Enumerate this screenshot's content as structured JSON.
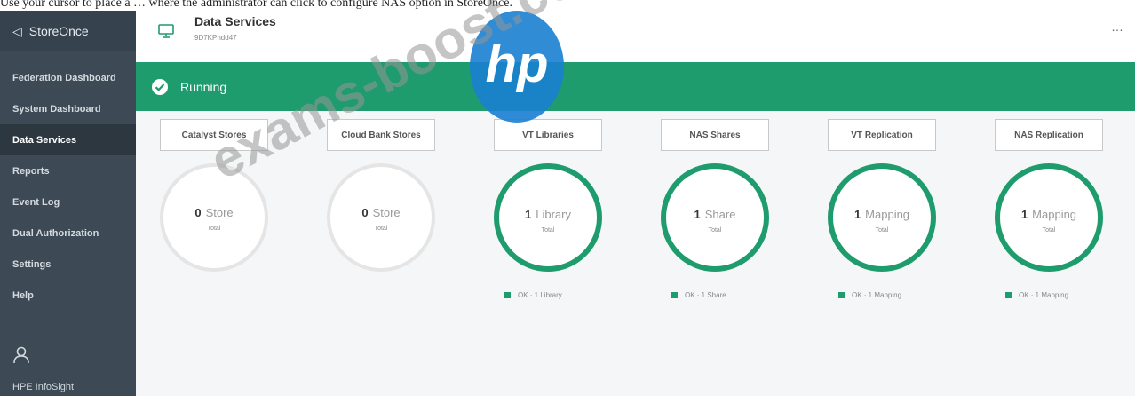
{
  "question": "Use your cursor to place a … where the administrator can click to configure NAS option in StoreOnce.",
  "sidebar": {
    "app_name": "StoreOnce",
    "back_icon": "chevron-left-icon",
    "items": [
      {
        "label": "Federation Dashboard",
        "active": false
      },
      {
        "label": "System Dashboard",
        "active": false
      },
      {
        "label": "Data Services",
        "active": true
      },
      {
        "label": "Reports",
        "active": false
      },
      {
        "label": "Event Log",
        "active": false
      },
      {
        "label": "Dual Authorization",
        "active": false
      },
      {
        "label": "Settings",
        "active": false
      },
      {
        "label": "Help",
        "active": false
      }
    ],
    "user_icon": "user-icon",
    "infosight": "HPE InfoSight"
  },
  "header": {
    "title": "Data Services",
    "subtitle": "9D7KPhdd47",
    "more": "…"
  },
  "banner": {
    "status": "Running",
    "color": "#1f9c6d"
  },
  "services": [
    {
      "button": "Catalyst Stores",
      "count": "0",
      "unit": "Store",
      "total_label": "Total",
      "active": false,
      "legend": ""
    },
    {
      "button": "Cloud Bank Stores",
      "count": "0",
      "unit": "Store",
      "total_label": "Total",
      "active": false,
      "legend": ""
    },
    {
      "button": "VT Libraries",
      "count": "1",
      "unit": "Library",
      "total_label": "Total",
      "active": true,
      "legend": "OK · 1 Library"
    },
    {
      "button": "NAS Shares",
      "count": "1",
      "unit": "Share",
      "total_label": "Total",
      "active": true,
      "legend": "OK · 1 Share"
    },
    {
      "button": "VT Replication",
      "count": "1",
      "unit": "Mapping",
      "total_label": "Total",
      "active": true,
      "legend": "OK · 1 Mapping"
    },
    {
      "button": "NAS Replication",
      "count": "1",
      "unit": "Mapping",
      "total_label": "Total",
      "active": true,
      "legend": "OK · 1 Mapping"
    }
  ],
  "watermark": {
    "text": "exams-boost.com",
    "logo": "hp-logo"
  }
}
